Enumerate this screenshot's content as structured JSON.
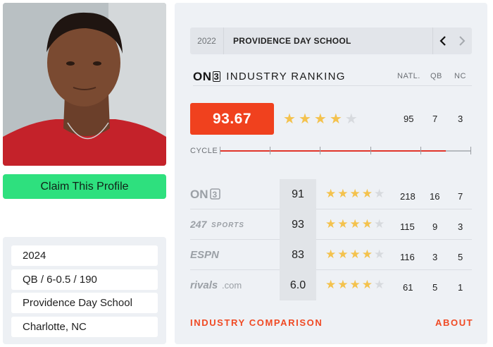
{
  "profile": {
    "claim_label": "Claim This Profile",
    "details": [
      "2024",
      "QB / 6-0.5 / 190",
      "Providence Day School",
      "Charlotte, NC"
    ]
  },
  "school_bar": {
    "year": "2022",
    "name": "PROVIDENCE DAY SCHOOL"
  },
  "industry": {
    "logo": "ON3",
    "title": "INDUSTRY RANKING",
    "columns": [
      "NATL.",
      "QB",
      "NC"
    ],
    "score": "93.67",
    "stars": 4,
    "natl": "95",
    "pos": "7",
    "state": "3"
  },
  "cycle": {
    "label": "CYCLE",
    "progress": 0.9
  },
  "services": [
    {
      "name": "On3",
      "score": "91",
      "stars": 4,
      "natl": "218",
      "pos": "16",
      "state": "7"
    },
    {
      "name": "247Sports",
      "score": "93",
      "stars": 4,
      "natl": "115",
      "pos": "9",
      "state": "3"
    },
    {
      "name": "ESPN",
      "score": "83",
      "stars": 4,
      "natl": "116",
      "pos": "3",
      "state": "5"
    },
    {
      "name": "rivals.com",
      "score": "6.0",
      "stars": 4,
      "natl": "61",
      "pos": "5",
      "state": "1"
    }
  ],
  "footer": {
    "comparison": "INDUSTRY COMPARISON",
    "about": "ABOUT"
  },
  "colors": {
    "accent": "#f0411e",
    "claim": "#2ee07e",
    "star": "#f4c24d"
  }
}
